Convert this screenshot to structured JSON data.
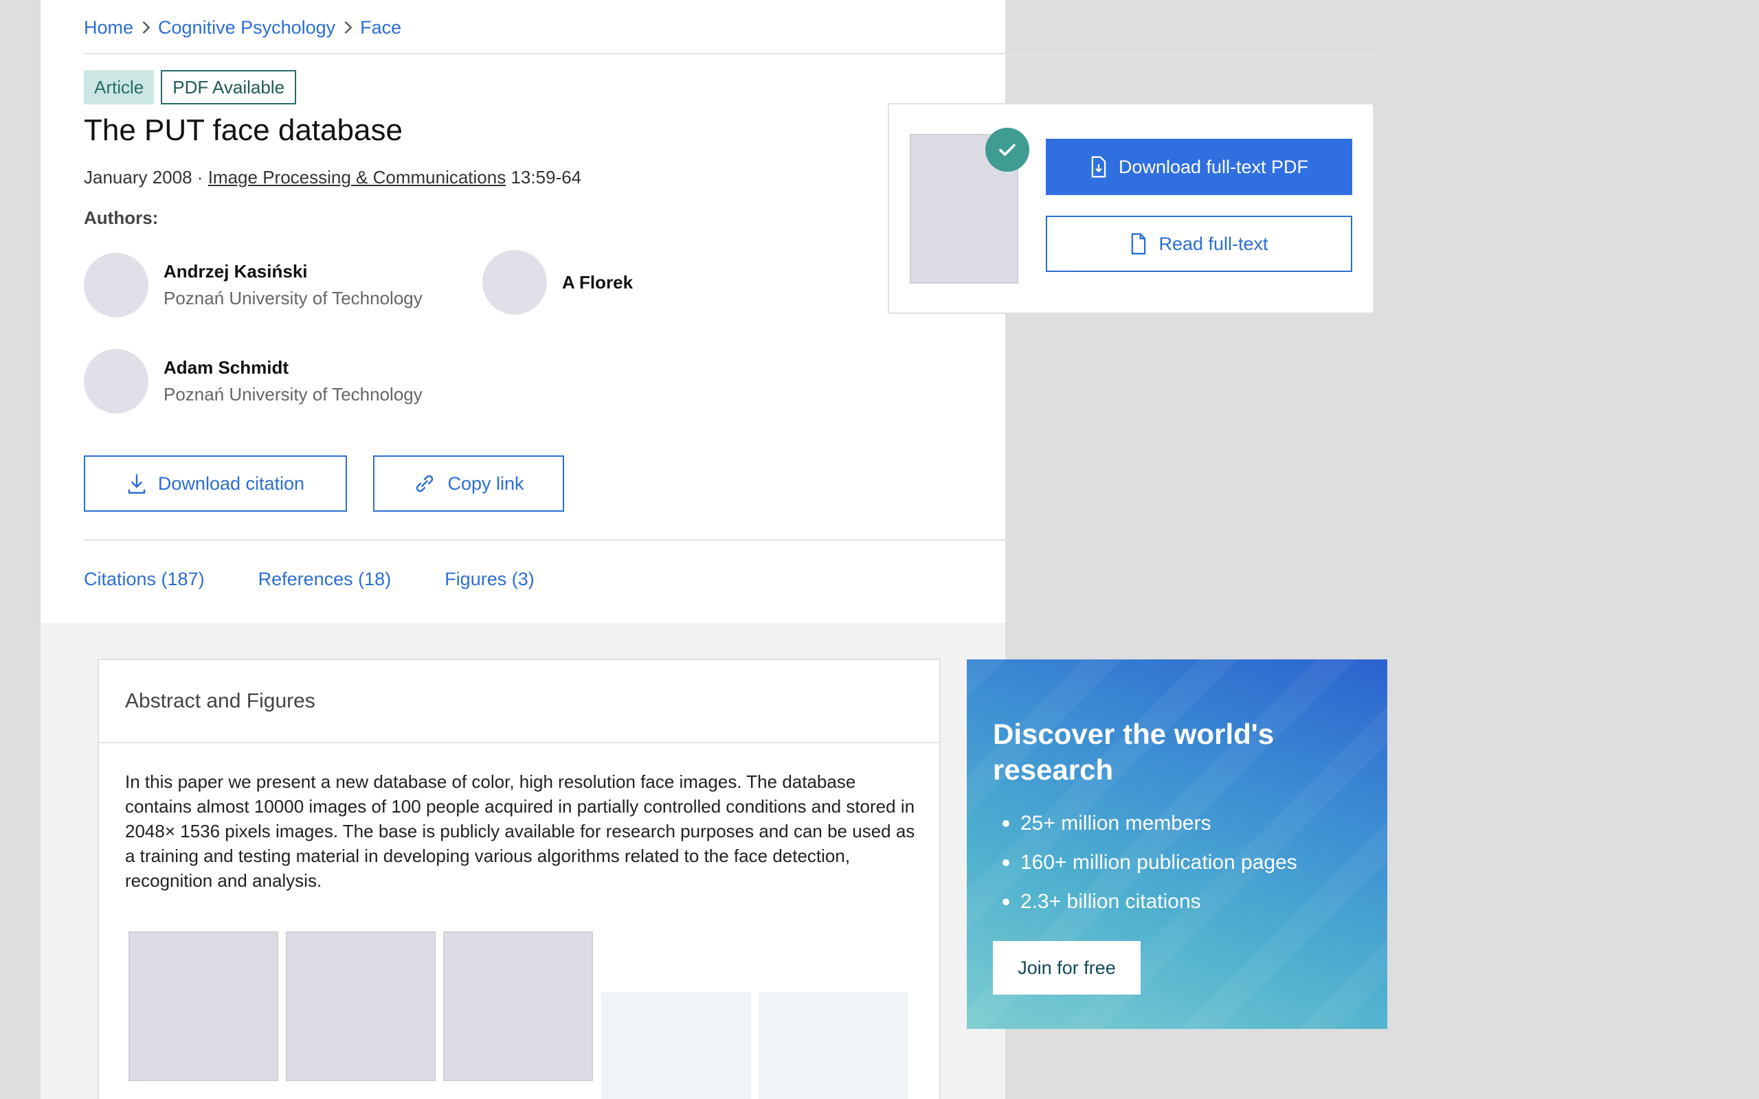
{
  "breadcrumb": {
    "items": [
      "Home",
      "Cognitive Psychology",
      "Face"
    ]
  },
  "badges": {
    "type": "Article",
    "pdf": "PDF Available"
  },
  "article": {
    "title": "The PUT face database",
    "date": "January 2008",
    "separator": "·",
    "journal": "Image Processing & Communications",
    "pages": "13:59-64"
  },
  "authors": {
    "label": "Authors:",
    "list": [
      {
        "name": "Andrzej Kasiński",
        "affiliation": "Poznań University of Technology"
      },
      {
        "name": "A Florek",
        "affiliation": ""
      },
      {
        "name": "Adam Schmidt",
        "affiliation": "Poznań University of Technology"
      }
    ]
  },
  "actions": {
    "download_citation": "Download citation",
    "copy_link": "Copy link"
  },
  "tabs": [
    "Citations (187)",
    "References (18)",
    "Figures (3)"
  ],
  "fulltext": {
    "download_pdf": "Download full-text PDF",
    "read": "Read full-text"
  },
  "abstract": {
    "heading": "Abstract and Figures",
    "text": "In this paper we present a new database of color, high resolution face images. The database contains almost 10000 images of 100 people acquired in partially controlled conditions and stored in 2048× 1536 pixels images. The base is publicly available for research purposes and can be used as a training and testing material in developing various algorithms related to the face detection, recognition and analysis."
  },
  "promo": {
    "heading": "Discover the world's research",
    "bullets": [
      "25+ million members",
      "160+ million publication pages",
      "2.3+ billion citations"
    ],
    "join": "Join for free"
  },
  "colors": {
    "link_blue": "#2c6ed5",
    "primary_button": "#2f6fe0",
    "article_badge_bg": "#cce6e4",
    "teal_check": "#3f9c92"
  }
}
